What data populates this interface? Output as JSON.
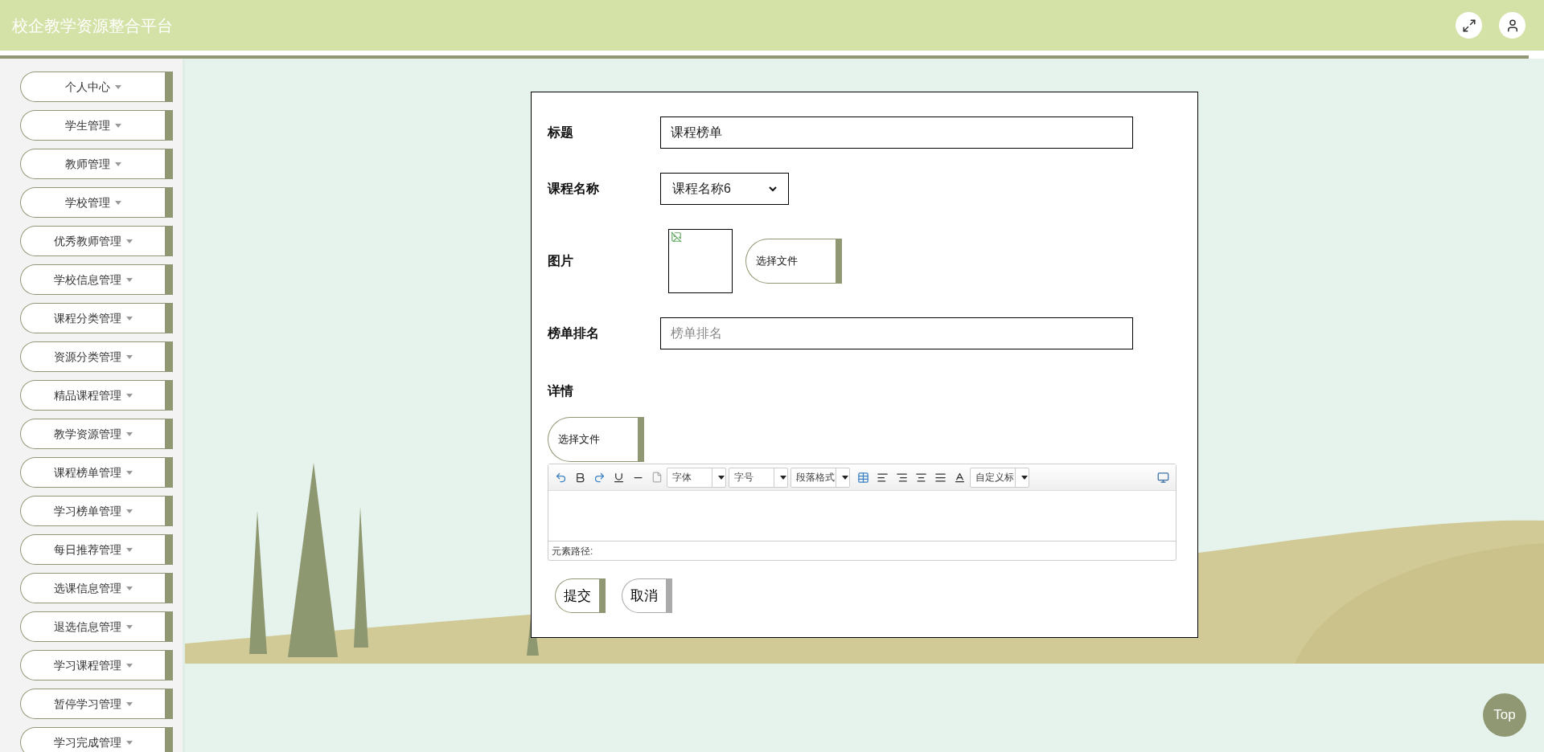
{
  "header": {
    "title": "校企教学资源整合平台"
  },
  "sidebar": {
    "items": [
      {
        "label": "个人中心"
      },
      {
        "label": "学生管理"
      },
      {
        "label": "教师管理"
      },
      {
        "label": "学校管理"
      },
      {
        "label": "优秀教师管理"
      },
      {
        "label": "学校信息管理"
      },
      {
        "label": "课程分类管理"
      },
      {
        "label": "资源分类管理"
      },
      {
        "label": "精品课程管理"
      },
      {
        "label": "教学资源管理"
      },
      {
        "label": "课程榜单管理"
      },
      {
        "label": "学习榜单管理"
      },
      {
        "label": "每日推荐管理"
      },
      {
        "label": "选课信息管理"
      },
      {
        "label": "退选信息管理"
      },
      {
        "label": "学习课程管理"
      },
      {
        "label": "暂停学习管理"
      },
      {
        "label": "学习完成管理"
      }
    ]
  },
  "form": {
    "fields": [
      {
        "kind": "text",
        "label": "标题",
        "value": "课程榜单"
      },
      {
        "kind": "select",
        "label": "课程名称",
        "value": "课程名称6"
      },
      {
        "kind": "image",
        "label": "图片",
        "button": "选择文件"
      },
      {
        "kind": "text",
        "label": "榜单排名",
        "placeholder": "榜单排名"
      }
    ],
    "details": {
      "label": "详情",
      "upload_button": "选择文件",
      "editor": {
        "dropdowns": [
          "字体",
          "字号",
          "段落格式"
        ],
        "heading_dropdown": "自定义标",
        "path_label": "元素路径:"
      }
    },
    "buttons": [
      {
        "label": "提交",
        "kind": "primary"
      },
      {
        "label": "取消",
        "kind": "secondary"
      }
    ]
  },
  "top_button": "Top"
}
